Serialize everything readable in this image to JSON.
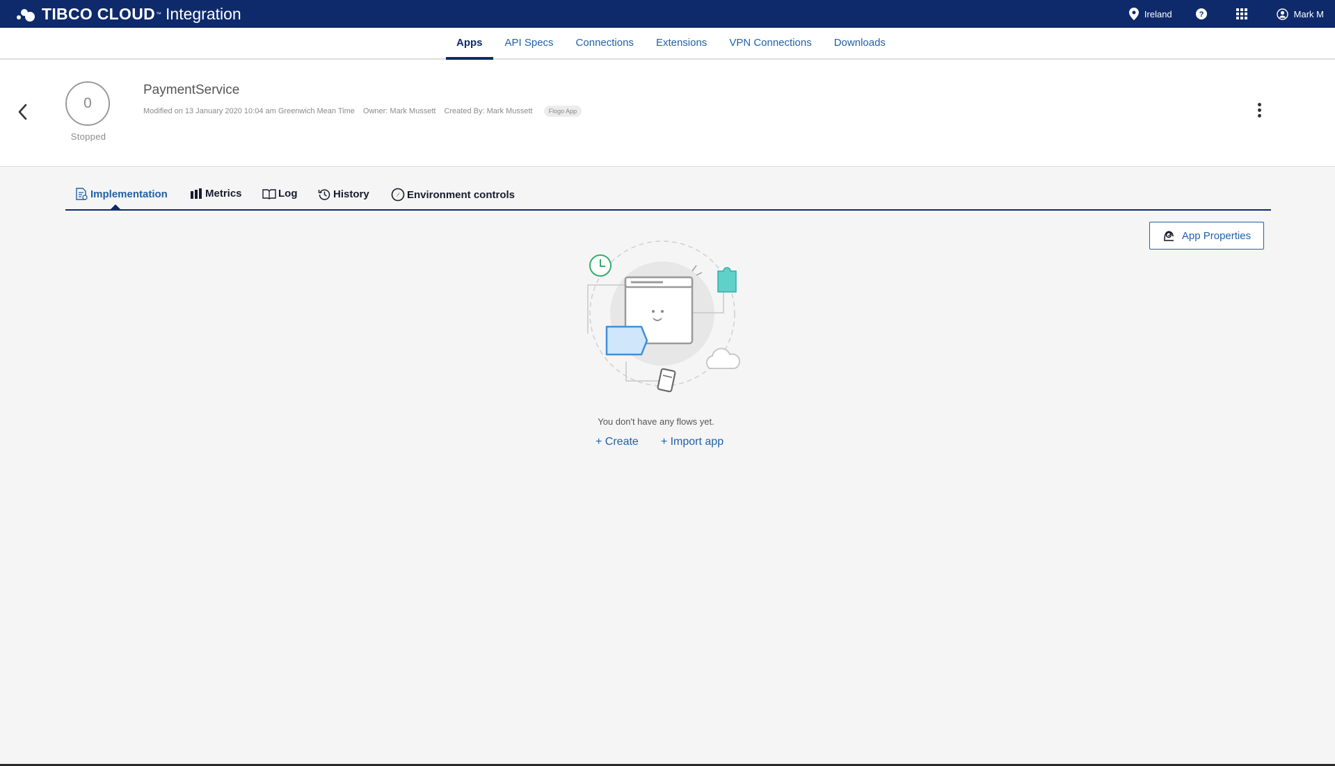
{
  "topbar": {
    "brand_name": "TIBCO CLOUD",
    "brand_sup": "™",
    "product": "Integration",
    "region": "Ireland",
    "user": "Mark M"
  },
  "nav": {
    "items": [
      {
        "label": "Apps",
        "active": true
      },
      {
        "label": "API Specs"
      },
      {
        "label": "Connections"
      },
      {
        "label": "Extensions"
      },
      {
        "label": "VPN Connections"
      },
      {
        "label": "Downloads"
      }
    ]
  },
  "app": {
    "instances": "0",
    "status": "Stopped",
    "name": "PaymentService",
    "modified": "Modified on 13 January 2020 10:04 am Greenwich Mean Time",
    "owner": "Owner: Mark Mussett",
    "created_by": "Created By: Mark Mussett",
    "type_badge": "Flogo App"
  },
  "tabs": [
    {
      "label": "Implementation",
      "icon": "implementation-icon",
      "active": true
    },
    {
      "label": "Metrics",
      "icon": "metrics-icon"
    },
    {
      "label": "Log",
      "icon": "log-icon"
    },
    {
      "label": "History",
      "icon": "history-icon"
    },
    {
      "label": "Environment controls",
      "icon": "environment-controls-icon"
    }
  ],
  "main": {
    "app_properties_label": "App Properties",
    "empty_message": "You don't have any flows yet.",
    "create_label": "+ Create",
    "import_label": "+ Import app"
  },
  "colors": {
    "header_bg": "#0e2a6b",
    "link": "#1f60a8",
    "page_bg": "#f5f5f5"
  }
}
